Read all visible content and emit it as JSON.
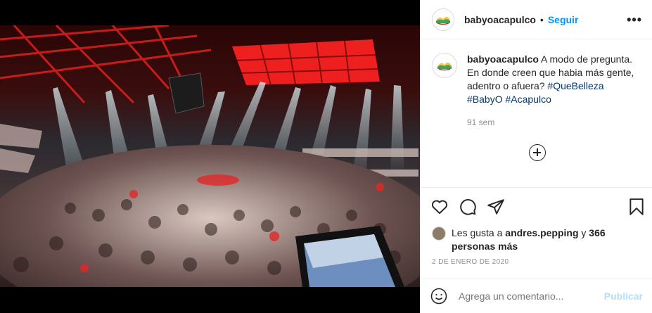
{
  "post": {
    "username": "babyoacapulco",
    "follow_label": "Seguir",
    "header_separator": "•",
    "more_label": "•••"
  },
  "caption": {
    "username": "babyoacapulco",
    "text": "A modo de pregunta. En donde creen que habia más gente, adentro o afuera?",
    "hashtags": [
      "#QueBelleza",
      "#BabyO",
      "#Acapulco"
    ],
    "time": "91 sem"
  },
  "likes": {
    "prefix": "Les gusta a",
    "user": "andres.pepping",
    "connector": "y",
    "others": "366 personas más"
  },
  "date": "2 DE ENERO DE 2020",
  "comment_box": {
    "placeholder": "Agrega un comentario...",
    "publish_label": "Publicar"
  },
  "icons": {
    "like": "heart-icon",
    "comment": "comment-icon",
    "share": "share-icon",
    "save": "bookmark-icon",
    "more": "more-options-icon",
    "load_more": "plus-circle-icon",
    "emoji": "emoji-icon"
  },
  "colors": {
    "accent": "#0095f6",
    "hashtag": "#00376b",
    "muted": "#8e8e8e",
    "publish_disabled": "#b2dffc"
  }
}
